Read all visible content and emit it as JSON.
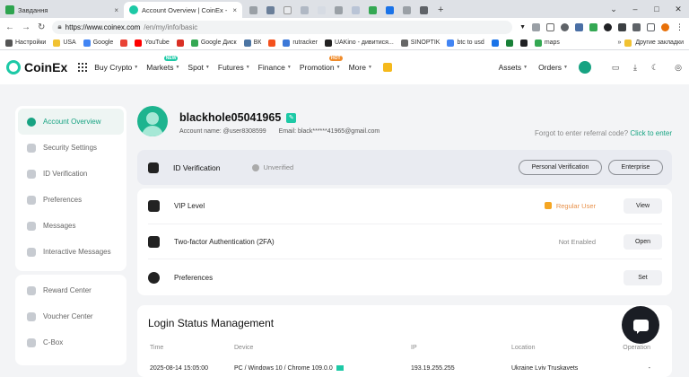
{
  "browser": {
    "tabs": [
      {
        "label": "Завдання",
        "favicon_color": "#2ea44f",
        "active": false
      },
      {
        "label": "Account Overview | CoinEx - The G",
        "favicon_color": "#1dc9a6",
        "active": true
      }
    ],
    "url_host": "https://www.coinex.com",
    "url_path": "/en/my/info/basic",
    "bookmarks": [
      {
        "label": "Настройки",
        "icon_color": "#555555"
      },
      {
        "label": "USA",
        "icon_color": "#f1c232"
      },
      {
        "label": "Google",
        "icon_color": "#4285f4"
      },
      {
        "label": "",
        "icon_color": "#e94235"
      },
      {
        "label": "YouTube",
        "icon_color": "#ff0000"
      },
      {
        "label": "",
        "icon_color": "#d93025"
      },
      {
        "label": "Google Диск",
        "icon_color": "#34a853"
      },
      {
        "label": "ВК",
        "icon_color": "#4c75a3"
      },
      {
        "label": "",
        "icon_color": "#f4511e"
      },
      {
        "label": "rutracker",
        "icon_color": "#3c78d8"
      },
      {
        "label": "UAKino - дивитися...",
        "icon_color": "#222222"
      },
      {
        "label": "SINOPTIK",
        "icon_color": "#666666"
      },
      {
        "label": "btc to usd",
        "icon_color": "#4285f4"
      },
      {
        "label": "",
        "icon_color": "#1a73e8"
      },
      {
        "label": "",
        "icon_color": "#188038"
      },
      {
        "label": "",
        "icon_color": "#202124"
      },
      {
        "label": "maps",
        "icon_color": "#34a853"
      }
    ],
    "bookmarks_more": "»",
    "other_bookmarks": "Другие закладки"
  },
  "header": {
    "logo_text": "CoinEx",
    "nav": [
      {
        "label": "Buy Crypto",
        "badge": ""
      },
      {
        "label": "Markets",
        "badge": "NEW"
      },
      {
        "label": "Spot",
        "badge": ""
      },
      {
        "label": "Futures",
        "badge": ""
      },
      {
        "label": "Finance",
        "badge": ""
      },
      {
        "label": "Promotion",
        "badge": "HOT"
      },
      {
        "label": "More",
        "badge": ""
      }
    ],
    "assets_label": "Assets",
    "orders_label": "Orders"
  },
  "sidebar": {
    "items": [
      {
        "label": "Account Overview",
        "active": true
      },
      {
        "label": "Security Settings",
        "active": false
      },
      {
        "label": "ID Verification",
        "active": false
      },
      {
        "label": "Preferences",
        "active": false
      },
      {
        "label": "Messages",
        "active": false
      },
      {
        "label": "Interactive Messages",
        "active": false
      }
    ],
    "bottom_items": [
      {
        "label": "Reward Center"
      },
      {
        "label": "Voucher Center"
      },
      {
        "label": "C-Box"
      }
    ]
  },
  "profile": {
    "username": "blackhole05041965",
    "account_name_label": "Account name:",
    "account_name": "@user8308599",
    "email_label": "Email:",
    "email": "black******41965@gmail.com",
    "referral_text": "Forgot to enter referral code?",
    "referral_link": "Click to enter"
  },
  "id_verification": {
    "title": "ID Verification",
    "status": "Unverified",
    "personal_button": "Personal Verification",
    "enterprise_button": "Enterprise"
  },
  "settings_rows": [
    {
      "label": "VIP Level",
      "status": "Regular User",
      "button": "View"
    },
    {
      "label": "Two-factor Authentication (2FA)",
      "status": "Not Enabled",
      "button": "Open"
    },
    {
      "label": "Preferences",
      "status": "",
      "button": "Set"
    }
  ],
  "login_status": {
    "title": "Login Status Management",
    "columns": [
      "Time",
      "Device",
      "IP",
      "Location",
      "Operation"
    ],
    "rows": [
      {
        "time": "2025-08-14 15:05:00",
        "device": "PC / Windows 10 / Chrome 109.0.0",
        "ip": "193.19.255.255",
        "location": "Ukraine Lviv Truskavets",
        "operation": "-"
      }
    ]
  },
  "colors": {
    "accent": "#1dc9a6",
    "regular_user": "#e8914a"
  }
}
